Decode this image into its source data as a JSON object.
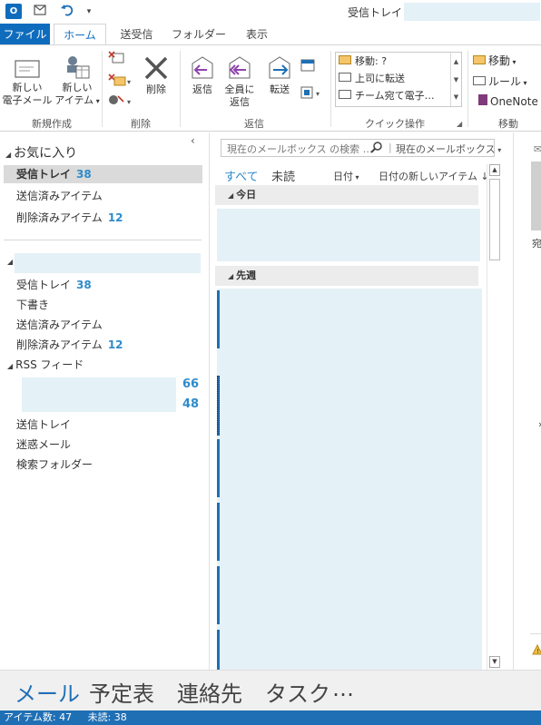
{
  "titlebar": {
    "title": "受信トレイ -",
    "app_icon_label": "O"
  },
  "ribbon_tabs": [
    {
      "label": "ファイル"
    },
    {
      "label": "ホーム"
    },
    {
      "label": "送受信"
    },
    {
      "label": "フォルダー"
    },
    {
      "label": "表示"
    }
  ],
  "ribbon": {
    "new_email": "新しい\n電子メール",
    "new_email_l1": "新しい",
    "new_email_l2": "電子メール",
    "new_items_l1": "新しい",
    "new_items_l2": "アイテム",
    "delete": "削除",
    "reply": "返信",
    "reply_all_l1": "全員に",
    "reply_all_l2": "返信",
    "forward": "転送",
    "groups": {
      "new": "新規作成",
      "delete": "削除",
      "respond": "返信",
      "quick_steps": "クイック操作",
      "move": "移動"
    },
    "quick_steps": [
      {
        "label": "移動: ?"
      },
      {
        "label": "上司に転送"
      },
      {
        "label": "チーム宛て電子…"
      }
    ],
    "move_items": [
      {
        "label": "移動"
      },
      {
        "label": "ルール"
      },
      {
        "label": "OneNote"
      }
    ]
  },
  "folder_pane": {
    "favorites_header": "お気に入り",
    "favorites": [
      {
        "label": "受信トレイ",
        "count": "38"
      },
      {
        "label": "送信済みアイテム",
        "count": ""
      },
      {
        "label": "削除済みアイテム",
        "count": "12"
      }
    ],
    "folders": [
      {
        "label": "受信トレイ",
        "count": "38"
      },
      {
        "label": "下書き",
        "count": ""
      },
      {
        "label": "送信済みアイテム",
        "count": ""
      },
      {
        "label": "削除済みアイテム",
        "count": "12"
      },
      {
        "label": "RSS フィード",
        "count": ""
      }
    ],
    "rss_counts": [
      "66",
      "48"
    ],
    "more_folders": [
      {
        "label": "送信トレイ"
      },
      {
        "label": "迷惑メール"
      },
      {
        "label": "検索フォルダー"
      }
    ]
  },
  "message_list": {
    "search_placeholder": "現在のメールボックス の検索 …",
    "search_scope": "現在のメールボックス",
    "filters": {
      "all": "すべて",
      "unread": "未読"
    },
    "sort_field": "日付",
    "sort_order": "日付の新しいアイテム",
    "groups": {
      "today": "今日",
      "last_week": "先週"
    }
  },
  "reading_pane": {
    "partial_label": "宛"
  },
  "navigation": {
    "mail": "メール",
    "calendar": "予定表",
    "people": "連絡先",
    "tasks": "タスク",
    "more": "…"
  },
  "status_bar": {
    "items_label": "アイテム数: 47",
    "unread_label": "未読: 38"
  },
  "colors": {
    "accent": "#0f6cbd",
    "count": "#2e8bcb",
    "redacted": "#e4f1f7"
  }
}
